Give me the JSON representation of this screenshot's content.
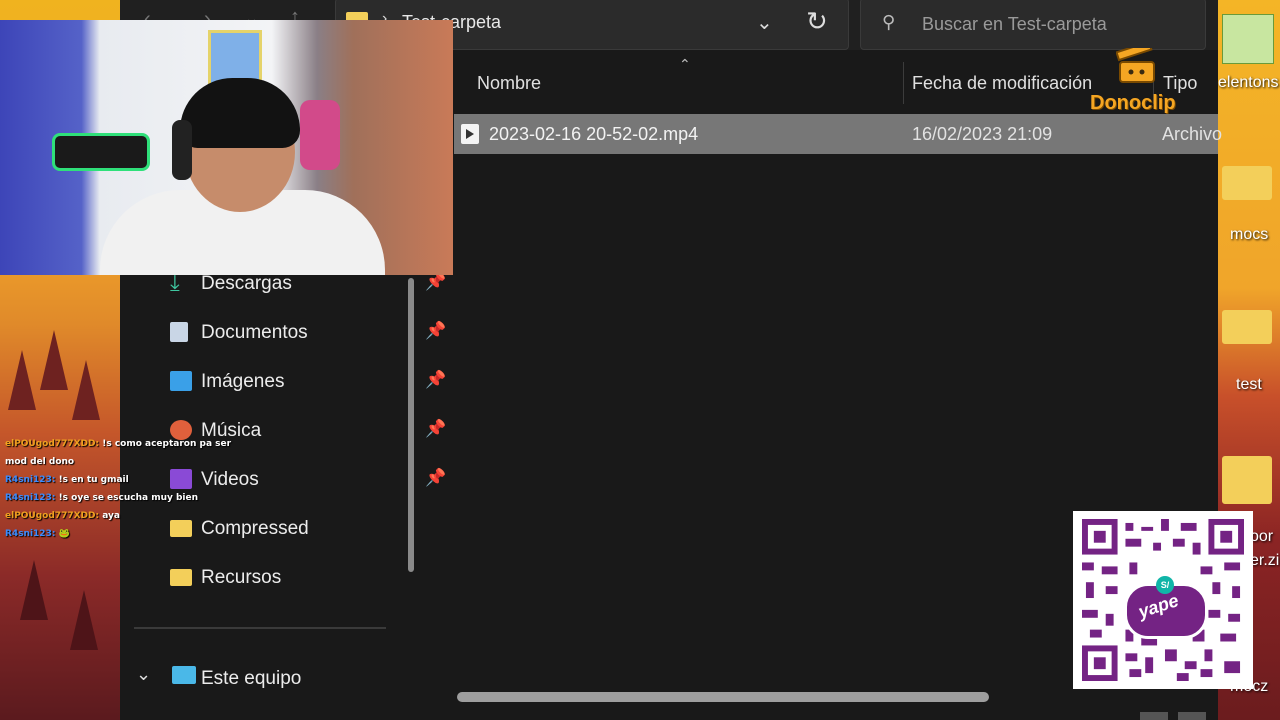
{
  "explorer": {
    "address_path": "Test-carpeta",
    "search_placeholder": "Buscar en Test-carpeta",
    "columns": {
      "name": "Nombre",
      "modified": "Fecha de modificación",
      "type": "Tipo"
    },
    "files": [
      {
        "name": "2023-02-16 20-52-02.mp4",
        "modified": "16/02/2023 21:09",
        "type": "Archivo"
      }
    ],
    "nav": [
      {
        "label": "Descargas",
        "icon": "download-icon",
        "pinned": true
      },
      {
        "label": "Documentos",
        "icon": "document-icon",
        "pinned": true
      },
      {
        "label": "Imágenes",
        "icon": "image-icon",
        "pinned": true
      },
      {
        "label": "Música",
        "icon": "music-icon",
        "pinned": true
      },
      {
        "label": "Videos",
        "icon": "video-icon",
        "pinned": true
      },
      {
        "label": "Compressed",
        "icon": "folder-icon",
        "pinned": false
      },
      {
        "label": "Recursos",
        "icon": "folder-icon",
        "pinned": false
      }
    ],
    "this_pc": "Este equipo"
  },
  "chat": [
    {
      "user": "elPOUgod777XDD:",
      "user_color": "#f0a020",
      "message": "!s como aceptaron pa ser mod del dono"
    },
    {
      "user": "R4sni123:",
      "user_color": "#3a8cff",
      "message": "!s en tu gmail"
    },
    {
      "user": "R4sni123:",
      "user_color": "#3a8cff",
      "message": "!s oye se escucha muy bien"
    },
    {
      "user": "elPOUgod777XDD:",
      "user_color": "#f0a020",
      "message": "aya"
    },
    {
      "user": "R4sni123:",
      "user_color": "#3a8cff",
      "message": "🐸"
    }
  ],
  "donoclip": {
    "brand": "Donoclip"
  },
  "desktop_icons": [
    {
      "label": "elentons"
    },
    {
      "label": "mocs"
    },
    {
      "label": "test"
    },
    {
      "label": "oor"
    },
    {
      "label": "er.zi"
    },
    {
      "label": "mocz"
    }
  ],
  "yape": {
    "label": "yape",
    "currency": "S/"
  },
  "colors": {
    "accent_green": "#2fe07a",
    "yape_purple": "#742384",
    "donoclip_orange": "#f5a623",
    "selected_row": "#777777"
  }
}
